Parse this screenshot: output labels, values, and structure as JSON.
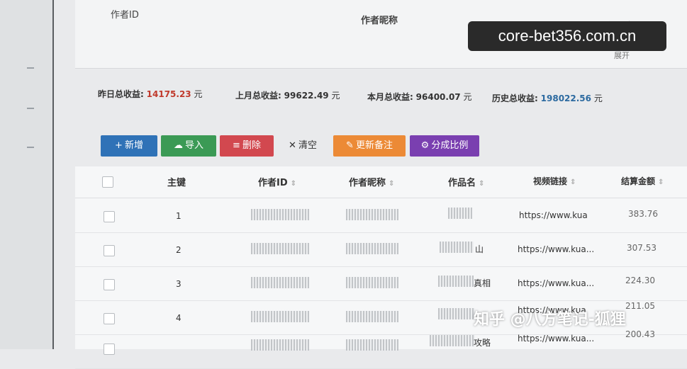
{
  "filter": {
    "author_id_label": "作者ID",
    "author_nick_label": "作者昵称",
    "work_name_label": "作品名",
    "expand_label": "展开"
  },
  "watermarks": {
    "top": "core-bet356.com.cn",
    "bottom": "知乎 @八方笔记-狐狸"
  },
  "stats": [
    {
      "key": "昨日总收益:",
      "value": "14175.23",
      "unit": "元",
      "color": "#c0392b"
    },
    {
      "key": "上月总收益:",
      "value": "99622.49",
      "unit": "元",
      "color": "#333333"
    },
    {
      "key": "本月总收益:",
      "value": "96400.07",
      "unit": "元",
      "color": "#333333"
    },
    {
      "key": "历史总收益:",
      "value": "198022.56",
      "unit": "元",
      "color": "#2c6aa0"
    }
  ],
  "toolbar": {
    "add": {
      "icon": "+",
      "label": "新增",
      "color": "#2f72b7"
    },
    "import": {
      "icon": "☁",
      "label": "导入",
      "color": "#3b9a55"
    },
    "delete": {
      "icon": "≡",
      "label": "删除",
      "color": "#d2484f"
    },
    "clear": {
      "icon": "✕",
      "label": "清空"
    },
    "update_note": {
      "icon": "✎",
      "label": "更新备注",
      "color": "#ec8a36"
    },
    "ratio": {
      "icon": "⚙",
      "label": "分成比例",
      "color": "#7a3fb0"
    }
  },
  "table": {
    "columns": {
      "pk": "主键",
      "author_id": "作者ID",
      "author_nick": "作者昵称",
      "work_name": "作品名",
      "video_link": "视频链接",
      "settle_amount": "结算金额"
    },
    "rows": [
      {
        "pk": "1",
        "work_suffix": "",
        "link": "https://www.kua",
        "amount": "383.76"
      },
      {
        "pk": "2",
        "work_suffix": "山",
        "link": "https://www.kua...",
        "amount": "307.53"
      },
      {
        "pk": "3",
        "work_suffix": "真相",
        "link": "https://www.kua...",
        "amount": "224.30"
      },
      {
        "pk": "4",
        "work_suffix": "",
        "link": "https://www.kua",
        "amount": "211.05"
      },
      {
        "pk": "",
        "work_suffix": "攻略",
        "link": "https://www.kua...",
        "amount": "200.43"
      }
    ]
  }
}
